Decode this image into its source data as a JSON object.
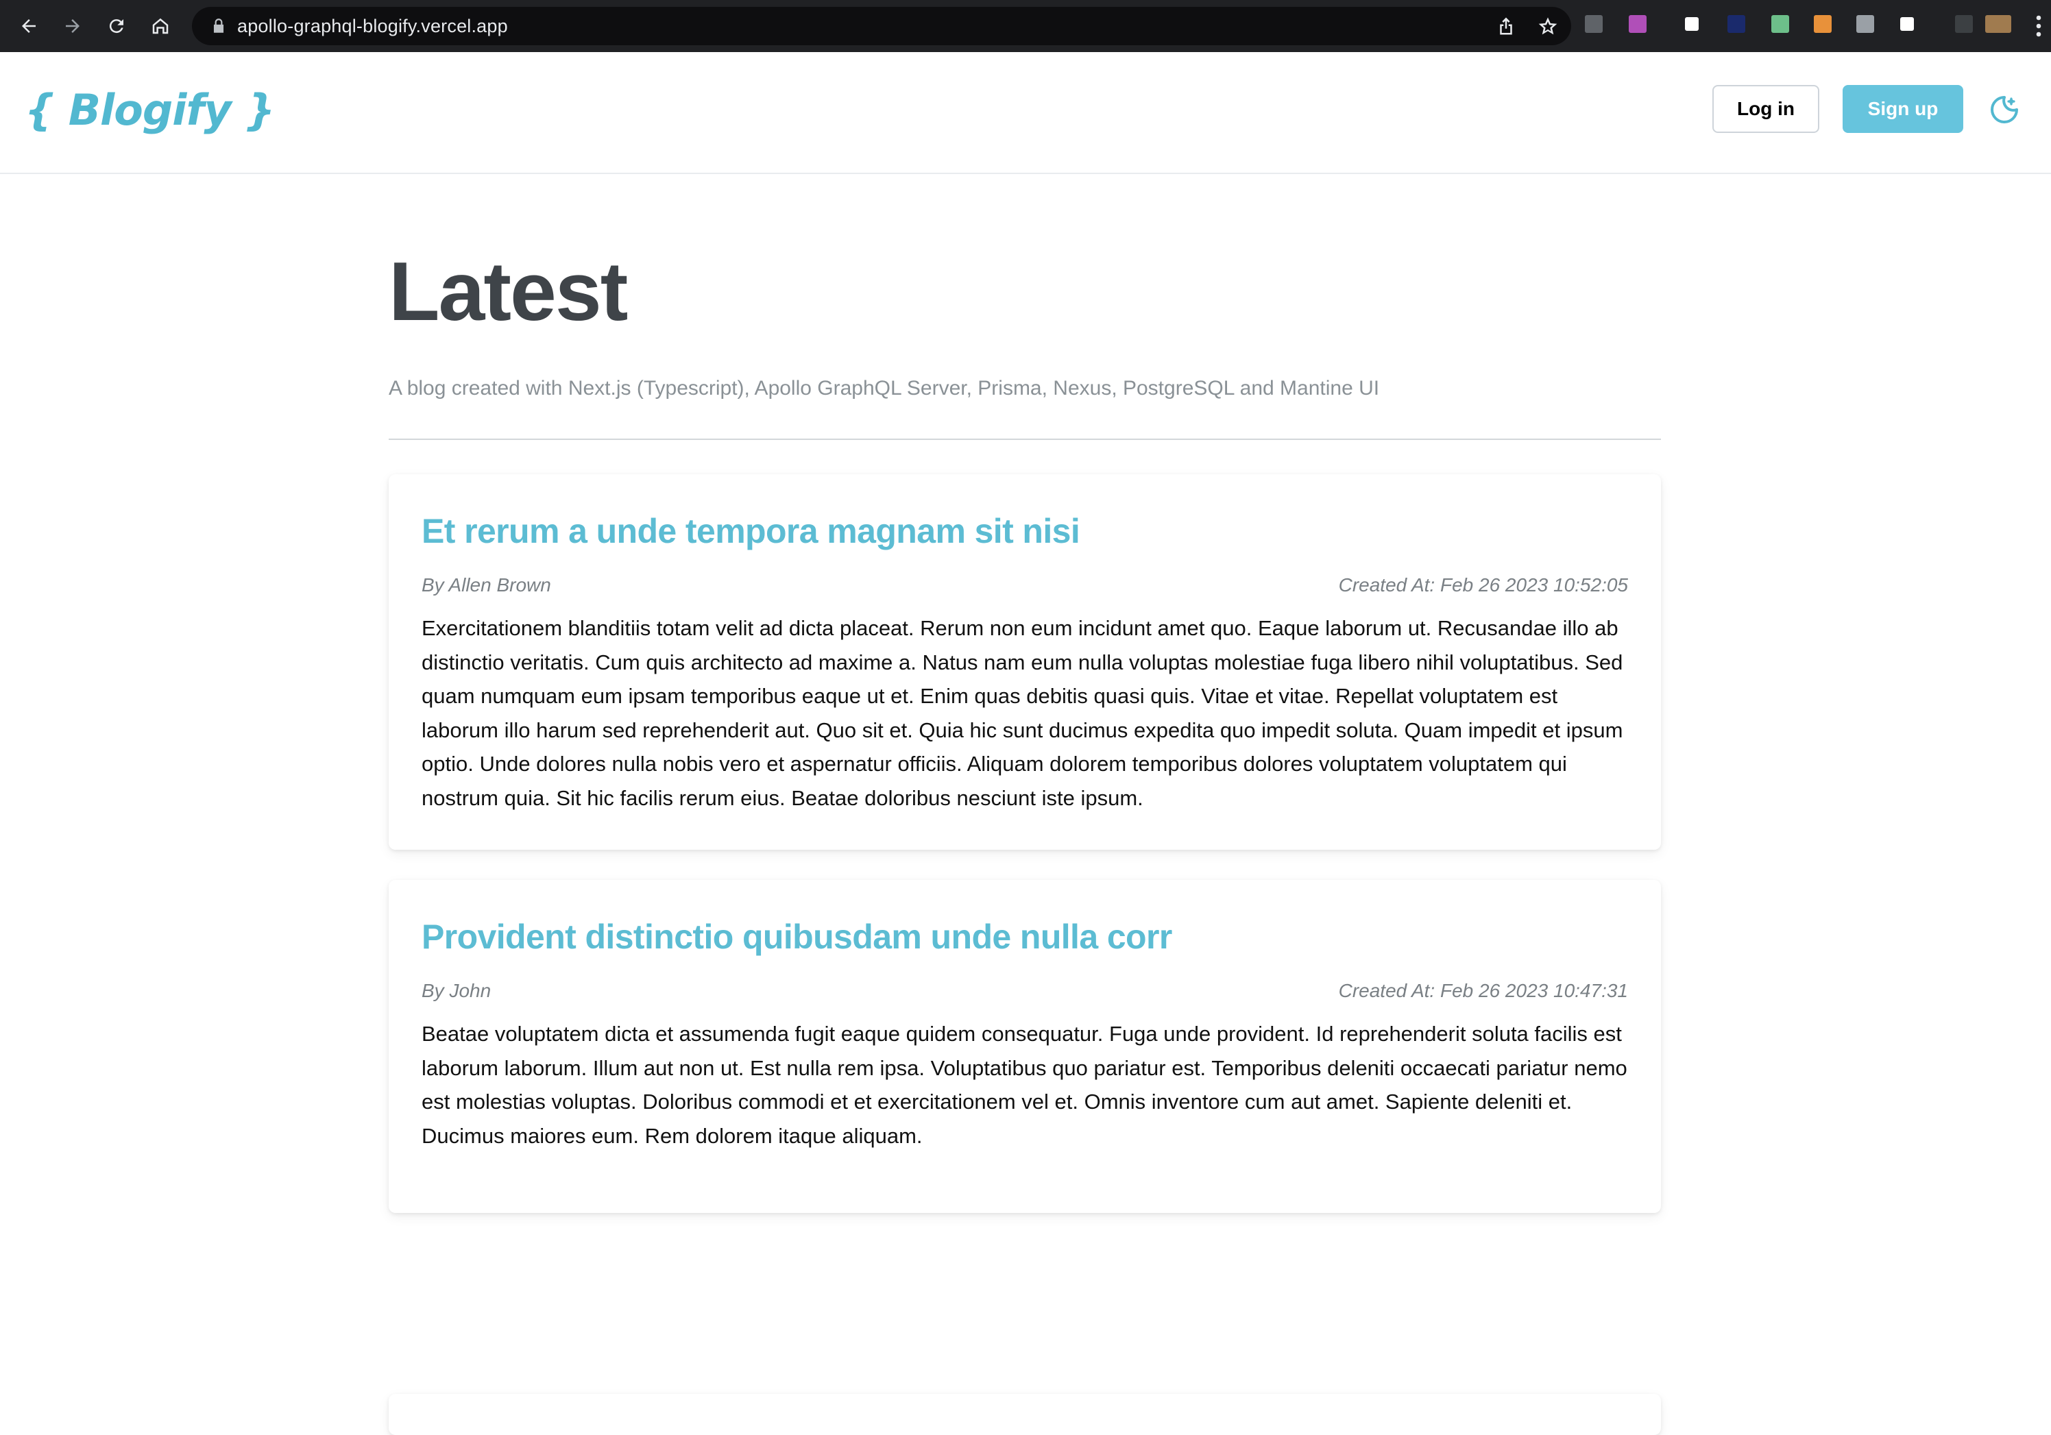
{
  "browser": {
    "url": "apollo-graphql-blogify.vercel.app",
    "extension_colors": [
      "#5f6368",
      "#b04fb8",
      "#ffffff",
      "#1a2a6c",
      "#6dbf8a",
      "#e8913a",
      "#9aa0a6",
      "#ffffff",
      "#3c4043",
      "#a07b4f"
    ]
  },
  "header": {
    "logo": "{ Blogify }",
    "login_label": "Log in",
    "signup_label": "Sign up",
    "accent_color": "#66c4dd"
  },
  "page": {
    "title": "Latest",
    "subtitle": "A blog created with Next.js (Typescript), Apollo GraphQL Server, Prisma, Nexus, PostgreSQL and Mantine UI"
  },
  "posts": [
    {
      "title": "Et rerum a unde tempora magnam sit nisi",
      "author": "By Allen Brown",
      "created": "Created At: Feb 26 2023 10:52:05",
      "body": "Exercitationem blanditiis totam velit ad dicta placeat. Rerum non eum incidunt amet quo. Eaque laborum ut. Recusandae illo ab distinctio veritatis. Cum quis architecto ad maxime a. Natus nam eum nulla voluptas molestiae fuga libero nihil voluptatibus. Sed quam numquam eum ipsam temporibus eaque ut et. Enim quas debitis quasi quis. Vitae et vitae. Repellat voluptatem est laborum illo harum sed reprehenderit aut. Quo sit et. Quia hic sunt ducimus expedita quo impedit soluta. Quam impedit et ipsum optio. Unde dolores nulla nobis vero et aspernatur officiis. Aliquam dolorem temporibus dolores voluptatem voluptatem qui nostrum quia. Sit hic facilis rerum eius. Beatae doloribus nesciunt iste ipsum."
    },
    {
      "title": "Provident distinctio quibusdam unde nulla corr",
      "author": "By John",
      "created": "Created At: Feb 26 2023 10:47:31",
      "body": "Beatae voluptatem dicta et assumenda fugit eaque quidem consequatur. Fuga unde provident. Id reprehenderit soluta facilis est laborum laborum. Illum aut non ut. Est nulla rem ipsa. Voluptatibus quo pariatur est. Temporibus deleniti occaecati pariatur nemo est molestias voluptas. Doloribus commodi et et exercitationem vel et. Omnis inventore cum aut amet. Sapiente deleniti et. Ducimus maiores eum. Rem dolorem itaque aliquam."
    }
  ]
}
